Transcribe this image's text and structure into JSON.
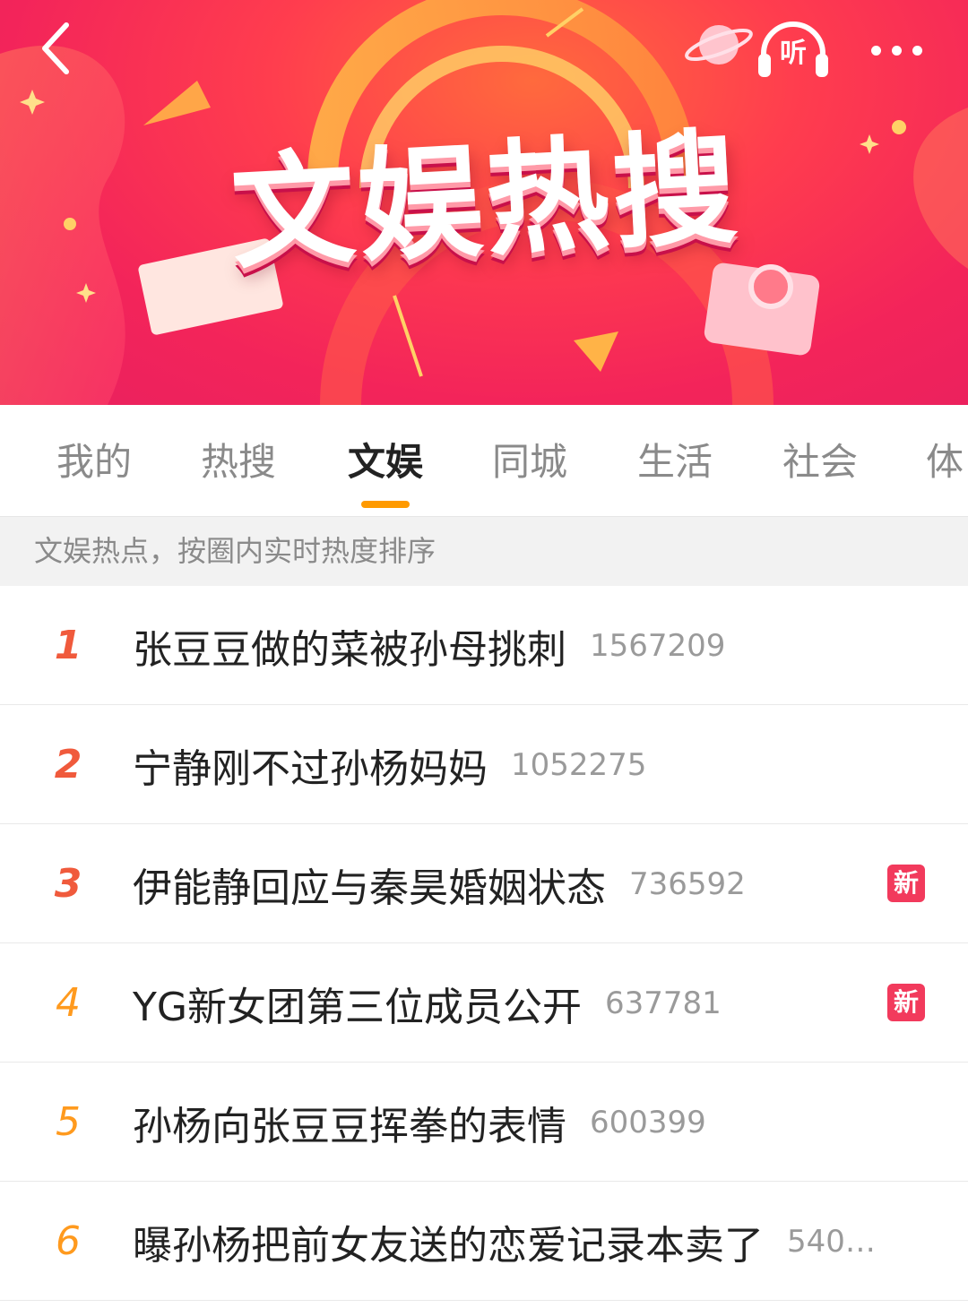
{
  "header": {
    "banner_title": "文娱热搜",
    "listen_label": "听",
    "icons": {
      "back": "chevron-left-icon",
      "listen": "headphones-icon",
      "more": "more-dots-icon"
    }
  },
  "tabs": [
    {
      "label": "我的",
      "active": false
    },
    {
      "label": "热搜",
      "active": false
    },
    {
      "label": "文娱",
      "active": true
    },
    {
      "label": "同城",
      "active": false
    },
    {
      "label": "生活",
      "active": false
    },
    {
      "label": "社会",
      "active": false
    },
    {
      "label": "体",
      "active": false
    }
  ],
  "hint": "文娱热点，按圈内实时热度排序",
  "colors": {
    "tab_indicator": "#ff9a00",
    "rank_top": "#f05a3c",
    "rank_normal": "#ff9a1e",
    "badge_new": "#f23a5c"
  },
  "list": [
    {
      "rank": "1",
      "title": "张豆豆做的菜被孙母挑刺",
      "count": "1567209",
      "badge": ""
    },
    {
      "rank": "2",
      "title": "宁静刚不过孙杨妈妈",
      "count": "1052275",
      "badge": ""
    },
    {
      "rank": "3",
      "title": "伊能静回应与秦昊婚姻状态",
      "count": "736592",
      "badge": "新"
    },
    {
      "rank": "4",
      "title": "YG新女团第三位成员公开",
      "count": "637781",
      "badge": "新"
    },
    {
      "rank": "5",
      "title": "孙杨向张豆豆挥拳的表情",
      "count": "600399",
      "badge": ""
    },
    {
      "rank": "6",
      "title": "曝孙杨把前女友送的恋爱记录本卖了",
      "count": "540…",
      "badge": ""
    }
  ]
}
